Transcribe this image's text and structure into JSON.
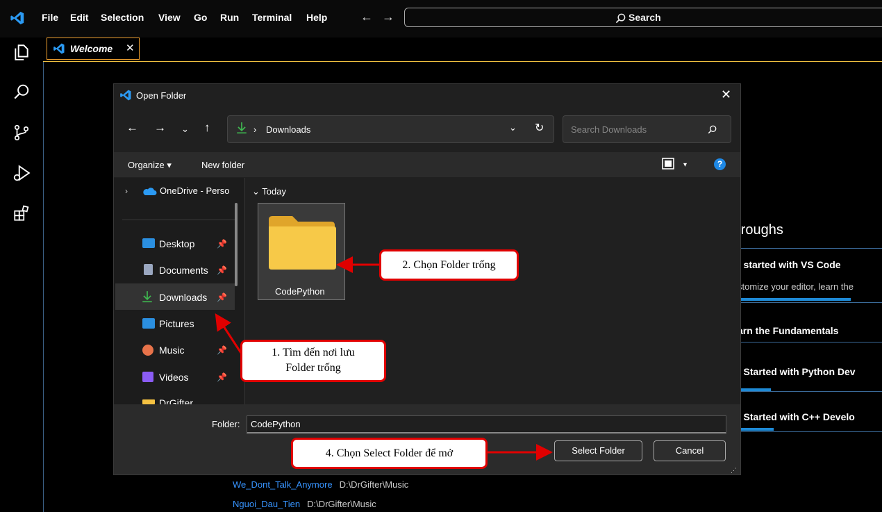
{
  "menu": {
    "items": [
      "File",
      "Edit",
      "Selection",
      "View",
      "Go",
      "Run",
      "Terminal",
      "Help"
    ],
    "search_label": "Search"
  },
  "tab": {
    "label": "Welcome"
  },
  "welcome": {
    "heading": "rroughs",
    "items": [
      {
        "title": "t started with VS Code",
        "desc": "stomize your editor, learn the"
      },
      {
        "title": "arn the Fundamentals"
      },
      {
        "title": "t Started with Python Dev"
      },
      {
        "title": "t Started with C++ Develo"
      }
    ],
    "recent": [
      {
        "name": "We_Dont_Talk_Anymore",
        "path": "D:\\DrGifter\\Music"
      },
      {
        "name": "Nguoi_Dau_Tien",
        "path": "D:\\DrGifter\\Music"
      }
    ]
  },
  "dialog": {
    "title": "Open Folder",
    "address": "Downloads",
    "search_placeholder": "Search Downloads",
    "organize": "Organize",
    "new_folder": "New folder",
    "help": "?",
    "nav": {
      "onedrive": "OneDrive - Perso",
      "items": [
        "Desktop",
        "Documents",
        "Downloads",
        "Pictures",
        "Music",
        "Videos",
        "DrGifter"
      ]
    },
    "group": "Today",
    "tile": "CodePython",
    "folder_label": "Folder:",
    "folder_value": "CodePython",
    "select_btn": "Select Folder",
    "cancel_btn": "Cancel"
  },
  "annotations": {
    "step1_line1": "1. Tìm đến nơi lưu",
    "step1_line2": "Folder trống",
    "step2": "2. Chọn Folder trống",
    "step4": "4. Chọn Select Folder để mở"
  },
  "colors": {
    "accent": "#1e88e5",
    "annotation": "#e10000",
    "folder": "#f5c242"
  }
}
